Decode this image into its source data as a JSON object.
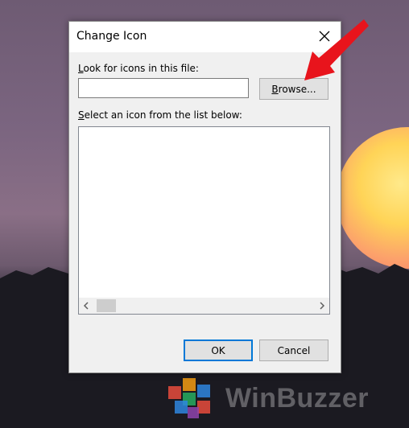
{
  "dialog": {
    "title": "Change Icon",
    "look_label_prefix": "L",
    "look_label_rest": "ook for icons in this file:",
    "file_input": {
      "value": "",
      "placeholder": ""
    },
    "browse_button": {
      "mnemonic": "B",
      "rest": "rowse..."
    },
    "select_label_prefix": "S",
    "select_label_rest": "elect an icon from the list below:",
    "ok_label": "OK",
    "cancel_label": "Cancel"
  },
  "watermark": {
    "text": "WinBuzzer"
  },
  "colors": {
    "annotation_arrow": "#e8141c",
    "focus_border": "#0078d7",
    "dialog_bg": "#f0f0f0"
  },
  "icons": {
    "close": "close-icon",
    "scroll_left": "chevron-left-icon",
    "scroll_right": "chevron-right-icon",
    "arrow": "red-arrow-annotation",
    "logo": "winbuzzer-logo"
  }
}
